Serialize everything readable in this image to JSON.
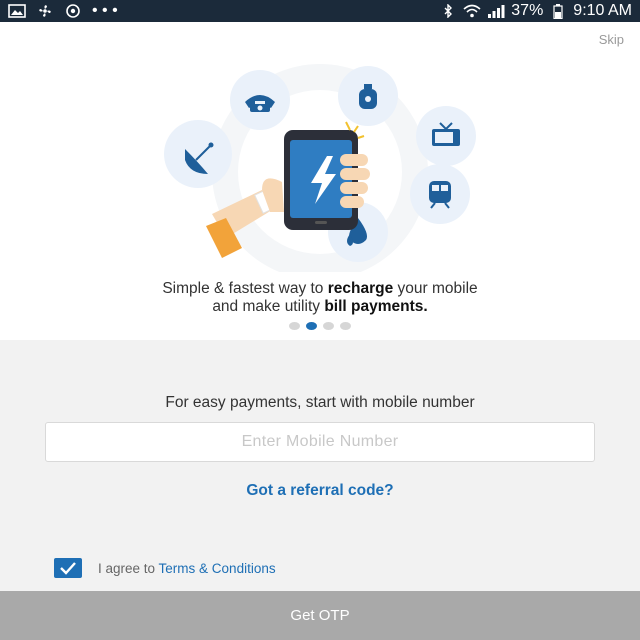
{
  "status_bar": {
    "icons_left": [
      "image-icon",
      "fan-icon",
      "sync-icon",
      "more-dots-icon"
    ],
    "more_text": "• • •",
    "icons_right": [
      "bluetooth-icon",
      "wifi-icon",
      "signal-icon",
      "battery-icon"
    ],
    "battery": "37%",
    "time": "9:10 AM"
  },
  "onboarding": {
    "skip_label": "Skip",
    "tagline_line1_prefix": "Simple & fastest way to ",
    "tagline_line1_bold": "recharge",
    "tagline_line1_suffix": " your mobile",
    "tagline_line2_prefix": "and make utility ",
    "tagline_line2_bold": "bill payments.",
    "carousel": {
      "count": 4,
      "active_index": 1
    },
    "service_icons": [
      "telephone-icon",
      "gas-cylinder-icon",
      "tv-icon",
      "train-icon",
      "water-drop-icon",
      "satellite-dish-icon"
    ]
  },
  "login": {
    "prompt": "For easy payments, start with mobile number",
    "mobile_placeholder": "Enter Mobile Number",
    "mobile_value": "",
    "referral_link": "Got a referral code?",
    "agree_prefix": "I agree to ",
    "terms_link": "Terms & Conditions",
    "agree_checked": true,
    "otp_button": "Get OTP"
  },
  "colors": {
    "accent": "#1e6fb5",
    "status_bar_bg": "#1b2a3a",
    "button_disabled": "#a9a9a9",
    "page_bg": "#f2f2f2"
  }
}
